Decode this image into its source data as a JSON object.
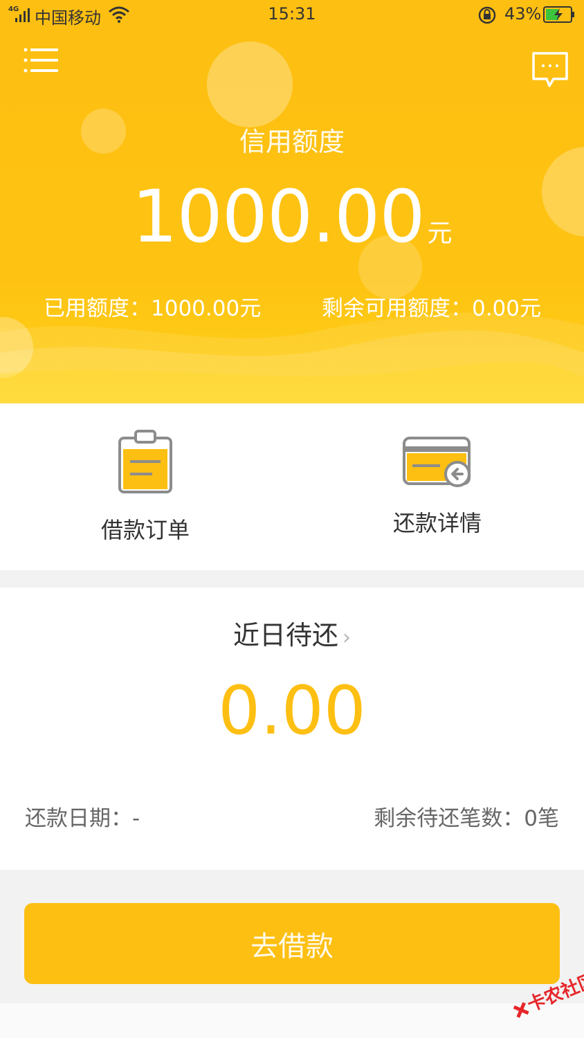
{
  "status_bar": {
    "network": "4G",
    "carrier": "中国移动",
    "time": "15:31",
    "battery": "43%"
  },
  "header": {
    "credit_label": "信用额度",
    "credit_value": "1000.00",
    "credit_unit": "元",
    "used": "已用额度：1000.00元",
    "remaining": "剩余可用额度：0.00元"
  },
  "shortcuts": [
    {
      "label": "借款订单",
      "icon": "clipboard-icon"
    },
    {
      "label": "还款详情",
      "icon": "card-repay-icon"
    }
  ],
  "recent_due": {
    "title": "近日待还",
    "amount": "0.00",
    "repay_date": "还款日期：-",
    "remaining_count": "剩余待还笔数：0笔"
  },
  "action": {
    "borrow_label": "去借款"
  },
  "watermark": {
    "text": "卡农社区"
  },
  "colors": {
    "accent": "#fdbf12",
    "text_dark": "#333333",
    "text_muted": "#666666"
  }
}
